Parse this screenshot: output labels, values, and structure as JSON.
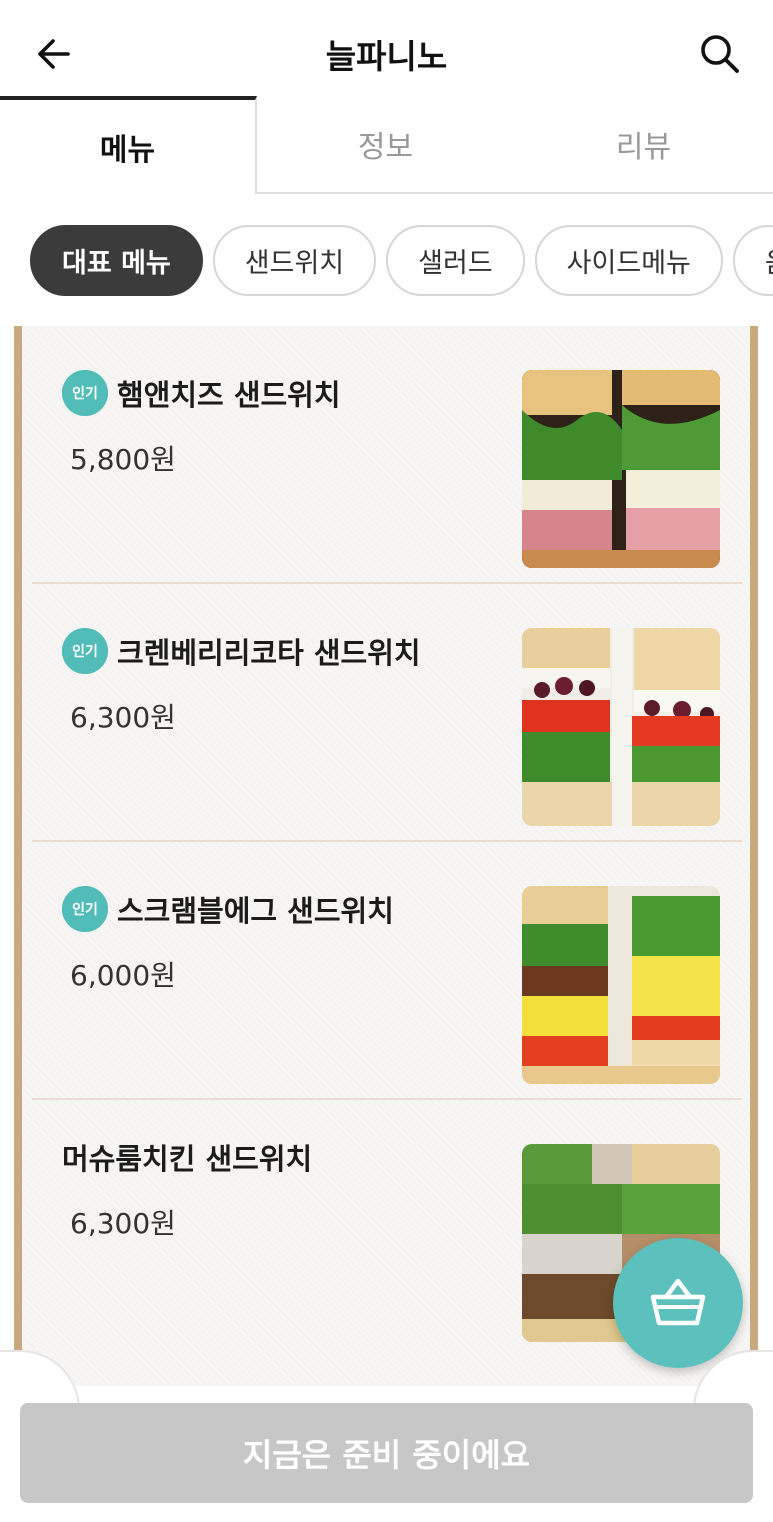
{
  "header": {
    "title": "늘파니노",
    "back_icon": "arrow-left-icon",
    "search_icon": "search-icon"
  },
  "tabs": [
    {
      "label": "메뉴",
      "active": true
    },
    {
      "label": "정보",
      "active": false
    },
    {
      "label": "리뷰",
      "active": false
    }
  ],
  "categories": [
    {
      "label": "대표 메뉴",
      "active": true
    },
    {
      "label": "샌드위치",
      "active": false
    },
    {
      "label": "샐러드",
      "active": false
    },
    {
      "label": "사이드메뉴",
      "active": false
    },
    {
      "label": "음료",
      "active": false
    }
  ],
  "menu_items": [
    {
      "badge": "인기",
      "name": "햄앤치즈 샌드위치",
      "price": "5,800원"
    },
    {
      "badge": "인기",
      "name": "크렌베리리코타 샌드위치",
      "price": "6,300원"
    },
    {
      "badge": "인기",
      "name": "스크램블에그 샌드위치",
      "price": "6,000원"
    },
    {
      "badge": "",
      "name": "머슈룸치킨 샌드위치",
      "price": "6,300원"
    }
  ],
  "cart": {
    "icon": "basket-icon"
  },
  "bottom": {
    "status_label": "지금은 준비 중이에요"
  },
  "colors": {
    "accent_teal": "#5cc1bc",
    "badge_teal": "#52bdb8",
    "board_frame": "#c9a97f",
    "chip_active": "#3b3b3b",
    "disabled_button": "#c7c7c7"
  }
}
